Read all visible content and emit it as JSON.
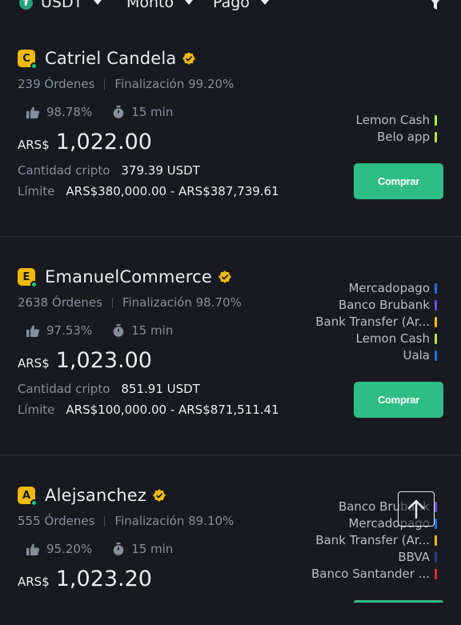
{
  "filters": {
    "coin": "USDT",
    "amount": "Monto",
    "payment": "Pago"
  },
  "colors": {
    "accent_buy": "#2ebd85",
    "avatar_bg": "#f0b90b",
    "verified": "#f0b90b",
    "pay_yellow": "#f0b90b",
    "pay_blue": "#1f6fe5",
    "pay_purple": "#6e4ce0",
    "pay_green": "#b6e83a",
    "pay_navy": "#2f3a8c",
    "pay_red": "#e0283b"
  },
  "offers": [
    {
      "initial": "C",
      "name": "Catriel Candela",
      "orders": "239 Órdenes",
      "completion": "Finalización 99.20%",
      "like_rate": "98.78%",
      "time": "15 min",
      "currency": "ARS$",
      "price": "1,022.00",
      "crypto_label": "Cantidad cripto",
      "crypto_amount": "379.39 USDT",
      "limit_label": "Límite",
      "limit_value": "ARS$380,000.00 - ARS$387,739.61",
      "payments": [
        {
          "name": "Lemon Cash",
          "color": "#b6e83a"
        },
        {
          "name": "Belo app",
          "color": "#b6e83a"
        }
      ],
      "buy_label": "Comprar"
    },
    {
      "initial": "E",
      "name": "EmanuelCommerce",
      "orders": "2638 Órdenes",
      "completion": "Finalización 98.70%",
      "like_rate": "97.53%",
      "time": "15 min",
      "currency": "ARS$",
      "price": "1,023.00",
      "crypto_label": "Cantidad cripto",
      "crypto_amount": "851.91 USDT",
      "limit_label": "Límite",
      "limit_value": "ARS$100,000.00 - ARS$871,511.41",
      "payments": [
        {
          "name": "Mercadopago",
          "color": "#1f6fe5"
        },
        {
          "name": "Banco Brubank",
          "color": "#6e4ce0"
        },
        {
          "name": "Bank Transfer (Ar...",
          "color": "#f0b90b"
        },
        {
          "name": "Lemon Cash",
          "color": "#b6e83a"
        },
        {
          "name": "Uala",
          "color": "#1f6fe5"
        }
      ],
      "buy_label": "Comprar"
    },
    {
      "initial": "A",
      "name": "Alejsanchez",
      "orders": "555 Órdenes",
      "completion": "Finalización 89.10%",
      "like_rate": "95.20%",
      "time": "15 min",
      "currency": "ARS$",
      "price": "1,023.20",
      "payments": [
        {
          "name": "Banco Brubank",
          "color": "#6e4ce0"
        },
        {
          "name": "Mercadopago",
          "color": "#1f6fe5"
        },
        {
          "name": "Bank Transfer (Ar...",
          "color": "#f0b90b"
        },
        {
          "name": "BBVA",
          "color": "#2f3a8c"
        },
        {
          "name": "Banco Santander ...",
          "color": "#e0283b"
        }
      ]
    }
  ]
}
